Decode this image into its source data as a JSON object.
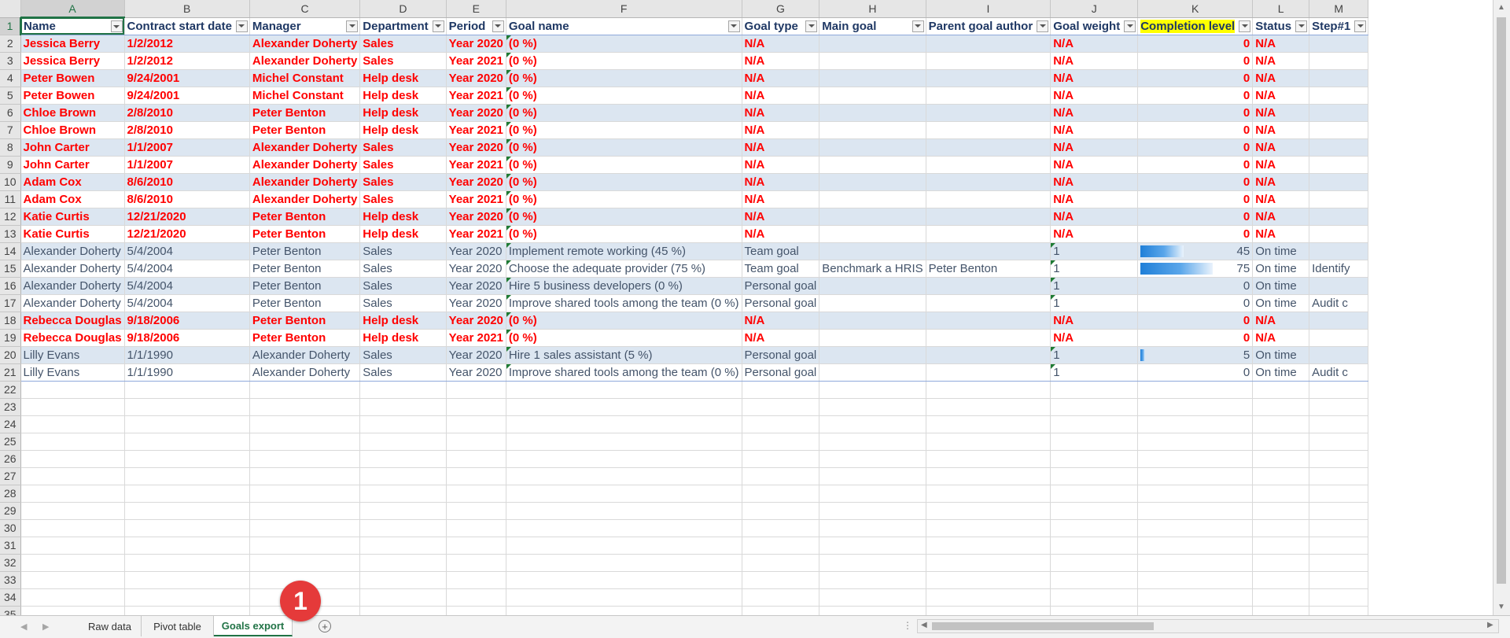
{
  "column_letters": [
    "A",
    "B",
    "C",
    "D",
    "E",
    "F",
    "G",
    "H",
    "I",
    "J",
    "K",
    "L",
    "M"
  ],
  "headers": [
    "Name",
    "Contract start date",
    "Manager",
    "Department",
    "Period",
    "Goal name",
    "Goal type",
    "Main goal",
    "Parent goal author",
    "Goal weight",
    "Completion level",
    "Status",
    "Step#1"
  ],
  "rows": [
    {
      "style": "red",
      "cells": [
        "Jessica Berry",
        "1/2/2012",
        "Alexander Doherty",
        "Sales",
        "Year 2020",
        "(0 %)",
        "N/A",
        "",
        "",
        "N/A",
        "0",
        "N/A",
        ""
      ],
      "bar": 0
    },
    {
      "style": "red",
      "cells": [
        "Jessica Berry",
        "1/2/2012",
        "Alexander Doherty",
        "Sales",
        "Year 2021",
        "(0 %)",
        "N/A",
        "",
        "",
        "N/A",
        "0",
        "N/A",
        ""
      ],
      "bar": 0
    },
    {
      "style": "red",
      "cells": [
        "Peter Bowen",
        "9/24/2001",
        "Michel Constant",
        "Help desk",
        "Year 2020",
        "(0 %)",
        "N/A",
        "",
        "",
        "N/A",
        "0",
        "N/A",
        ""
      ],
      "bar": 0
    },
    {
      "style": "red",
      "cells": [
        "Peter Bowen",
        "9/24/2001",
        "Michel Constant",
        "Help desk",
        "Year 2021",
        "(0 %)",
        "N/A",
        "",
        "",
        "N/A",
        "0",
        "N/A",
        ""
      ],
      "bar": 0
    },
    {
      "style": "red",
      "cells": [
        "Chloe Brown",
        "2/8/2010",
        "Peter Benton",
        "Help desk",
        "Year 2020",
        "(0 %)",
        "N/A",
        "",
        "",
        "N/A",
        "0",
        "N/A",
        ""
      ],
      "bar": 0
    },
    {
      "style": "red",
      "cells": [
        "Chloe Brown",
        "2/8/2010",
        "Peter Benton",
        "Help desk",
        "Year 2021",
        "(0 %)",
        "N/A",
        "",
        "",
        "N/A",
        "0",
        "N/A",
        ""
      ],
      "bar": 0
    },
    {
      "style": "red",
      "cells": [
        "John Carter",
        "1/1/2007",
        "Alexander Doherty",
        "Sales",
        "Year 2020",
        "(0 %)",
        "N/A",
        "",
        "",
        "N/A",
        "0",
        "N/A",
        ""
      ],
      "bar": 0
    },
    {
      "style": "red",
      "cells": [
        "John Carter",
        "1/1/2007",
        "Alexander Doherty",
        "Sales",
        "Year 2021",
        "(0 %)",
        "N/A",
        "",
        "",
        "N/A",
        "0",
        "N/A",
        ""
      ],
      "bar": 0
    },
    {
      "style": "red",
      "cells": [
        "Adam Cox",
        "8/6/2010",
        "Alexander Doherty",
        "Sales",
        "Year 2020",
        "(0 %)",
        "N/A",
        "",
        "",
        "N/A",
        "0",
        "N/A",
        ""
      ],
      "bar": 0
    },
    {
      "style": "red",
      "cells": [
        "Adam Cox",
        "8/6/2010",
        "Alexander Doherty",
        "Sales",
        "Year 2021",
        "(0 %)",
        "N/A",
        "",
        "",
        "N/A",
        "0",
        "N/A",
        ""
      ],
      "bar": 0
    },
    {
      "style": "red",
      "cells": [
        "Katie Curtis",
        "12/21/2020",
        "Peter Benton",
        "Help desk",
        "Year 2020",
        "(0 %)",
        "N/A",
        "",
        "",
        "N/A",
        "0",
        "N/A",
        ""
      ],
      "bar": 0
    },
    {
      "style": "red",
      "cells": [
        "Katie Curtis",
        "12/21/2020",
        "Peter Benton",
        "Help desk",
        "Year 2021",
        "(0 %)",
        "N/A",
        "",
        "",
        "N/A",
        "0",
        "N/A",
        ""
      ],
      "bar": 0
    },
    {
      "style": "blue",
      "cells": [
        "Alexander Doherty",
        "5/4/2004",
        "Peter Benton",
        "Sales",
        "Year 2020",
        "Implement remote working  (45 %)",
        "Team goal",
        "",
        "",
        "1",
        "45",
        "On time",
        ""
      ],
      "bar": 45
    },
    {
      "style": "blue",
      "cells": [
        "Alexander Doherty",
        "5/4/2004",
        "Peter Benton",
        "Sales",
        "Year 2020",
        "Choose the adequate provider (75 %)",
        "Team goal",
        "Benchmark a HRIS",
        "Peter Benton",
        "1",
        "75",
        "On time",
        "Identify"
      ],
      "bar": 75
    },
    {
      "style": "blue",
      "cells": [
        "Alexander Doherty",
        "5/4/2004",
        "Peter Benton",
        "Sales",
        "Year 2020",
        "Hire 5 business developers  (0 %)",
        "Personal goal",
        "",
        "",
        "1",
        "0",
        "On time",
        ""
      ],
      "bar": 0
    },
    {
      "style": "blue",
      "cells": [
        "Alexander Doherty",
        "5/4/2004",
        "Peter Benton",
        "Sales",
        "Year 2020",
        "Improve shared tools among the team (0 %)",
        "Personal goal",
        "",
        "",
        "1",
        "0",
        "On time",
        "Audit c"
      ],
      "bar": 0
    },
    {
      "style": "red",
      "cells": [
        "Rebecca Douglas",
        "9/18/2006",
        "Peter Benton",
        "Help desk",
        "Year 2020",
        "(0 %)",
        "N/A",
        "",
        "",
        "N/A",
        "0",
        "N/A",
        ""
      ],
      "bar": 0
    },
    {
      "style": "red",
      "cells": [
        "Rebecca Douglas",
        "9/18/2006",
        "Peter Benton",
        "Help desk",
        "Year 2021",
        "(0 %)",
        "N/A",
        "",
        "",
        "N/A",
        "0",
        "N/A",
        ""
      ],
      "bar": 0
    },
    {
      "style": "blue",
      "cells": [
        "Lilly Evans",
        "1/1/1990",
        "Alexander Doherty",
        "Sales",
        "Year 2020",
        "Hire 1 sales assistant (5 %)",
        "Personal goal",
        "",
        "",
        "1",
        "5",
        "On time",
        ""
      ],
      "bar": 5
    },
    {
      "style": "blue",
      "cells": [
        "Lilly Evans",
        "1/1/1990",
        "Alexander Doherty",
        "Sales",
        "Year 2020",
        "Improve shared tools among the team (0 %)",
        "Personal goal",
        "",
        "",
        "1",
        "0",
        "On time",
        "Audit c"
      ],
      "bar": 0
    }
  ],
  "empty_row_numbers": [
    22,
    23,
    24,
    25,
    26,
    27,
    28,
    29,
    30,
    31,
    32,
    33,
    34,
    35
  ],
  "sheet_tabs": [
    "Raw data",
    "Pivot table",
    "Goals export"
  ],
  "active_tab": "Goals export",
  "callout_number": "1",
  "highlight_color": "#ffff00",
  "accent_color": "#217346"
}
